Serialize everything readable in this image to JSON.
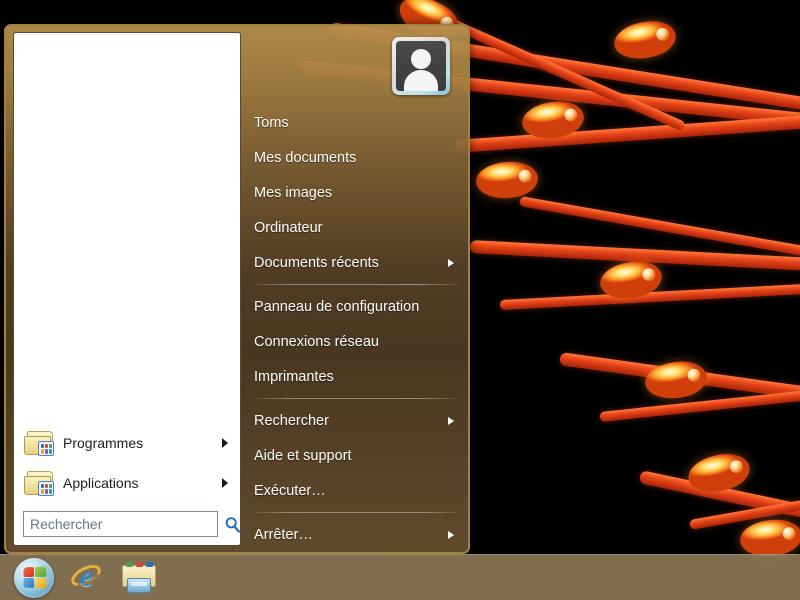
{
  "desktop": {
    "wallpaper_name": "flower-stamens-macro",
    "wallpaper_background": "#000000",
    "wallpaper_accent": "#e8441a"
  },
  "start_menu": {
    "accent_border": "#a2803f",
    "gradient_top": "#b7904c",
    "gradient_bottom": "#685030",
    "left_pane": {
      "background": "#ffffff",
      "programs": [
        {
          "label": "Programmes",
          "icon": "programs-folder-icon",
          "has_submenu": true
        },
        {
          "label": "Applications",
          "icon": "programs-folder-icon",
          "has_submenu": true
        }
      ],
      "search": {
        "placeholder": "Rechercher",
        "value": "",
        "icon": "search-magnifier-icon",
        "icon_color": "#1f6fbd"
      }
    },
    "right_pane": {
      "avatar": {
        "icon": "user-avatar-icon",
        "alt": "Toms"
      },
      "groups": [
        {
          "items": [
            {
              "label": "Toms",
              "has_submenu": false
            },
            {
              "label": "Mes documents",
              "has_submenu": false
            },
            {
              "label": "Mes images",
              "has_submenu": false
            },
            {
              "label": "Ordinateur",
              "has_submenu": false
            },
            {
              "label": "Documents récents",
              "has_submenu": true
            }
          ]
        },
        {
          "items": [
            {
              "label": "Panneau de configuration",
              "has_submenu": false
            },
            {
              "label": "Connexions réseau",
              "has_submenu": false
            },
            {
              "label": "Imprimantes",
              "has_submenu": false
            }
          ]
        },
        {
          "items": [
            {
              "label": "Rechercher",
              "has_submenu": true
            },
            {
              "label": "Aide et support",
              "has_submenu": false
            },
            {
              "label": "Exécuter…",
              "has_submenu": false
            }
          ]
        },
        {
          "items": [
            {
              "label": "Arrêter…",
              "has_submenu": true
            }
          ]
        }
      ]
    }
  },
  "taskbar": {
    "background": "#96805e",
    "buttons": [
      {
        "name": "start-orb",
        "icon": "windows-logo-icon",
        "label": ""
      },
      {
        "name": "internet-explorer",
        "icon": "internet-explorer-icon",
        "label": ""
      },
      {
        "name": "windows-explorer",
        "icon": "windows-explorer-folder-icon",
        "label": ""
      }
    ],
    "orb_colors": [
      "#e04a32",
      "#7fc242",
      "#3d8fd1",
      "#f2c230"
    ]
  }
}
